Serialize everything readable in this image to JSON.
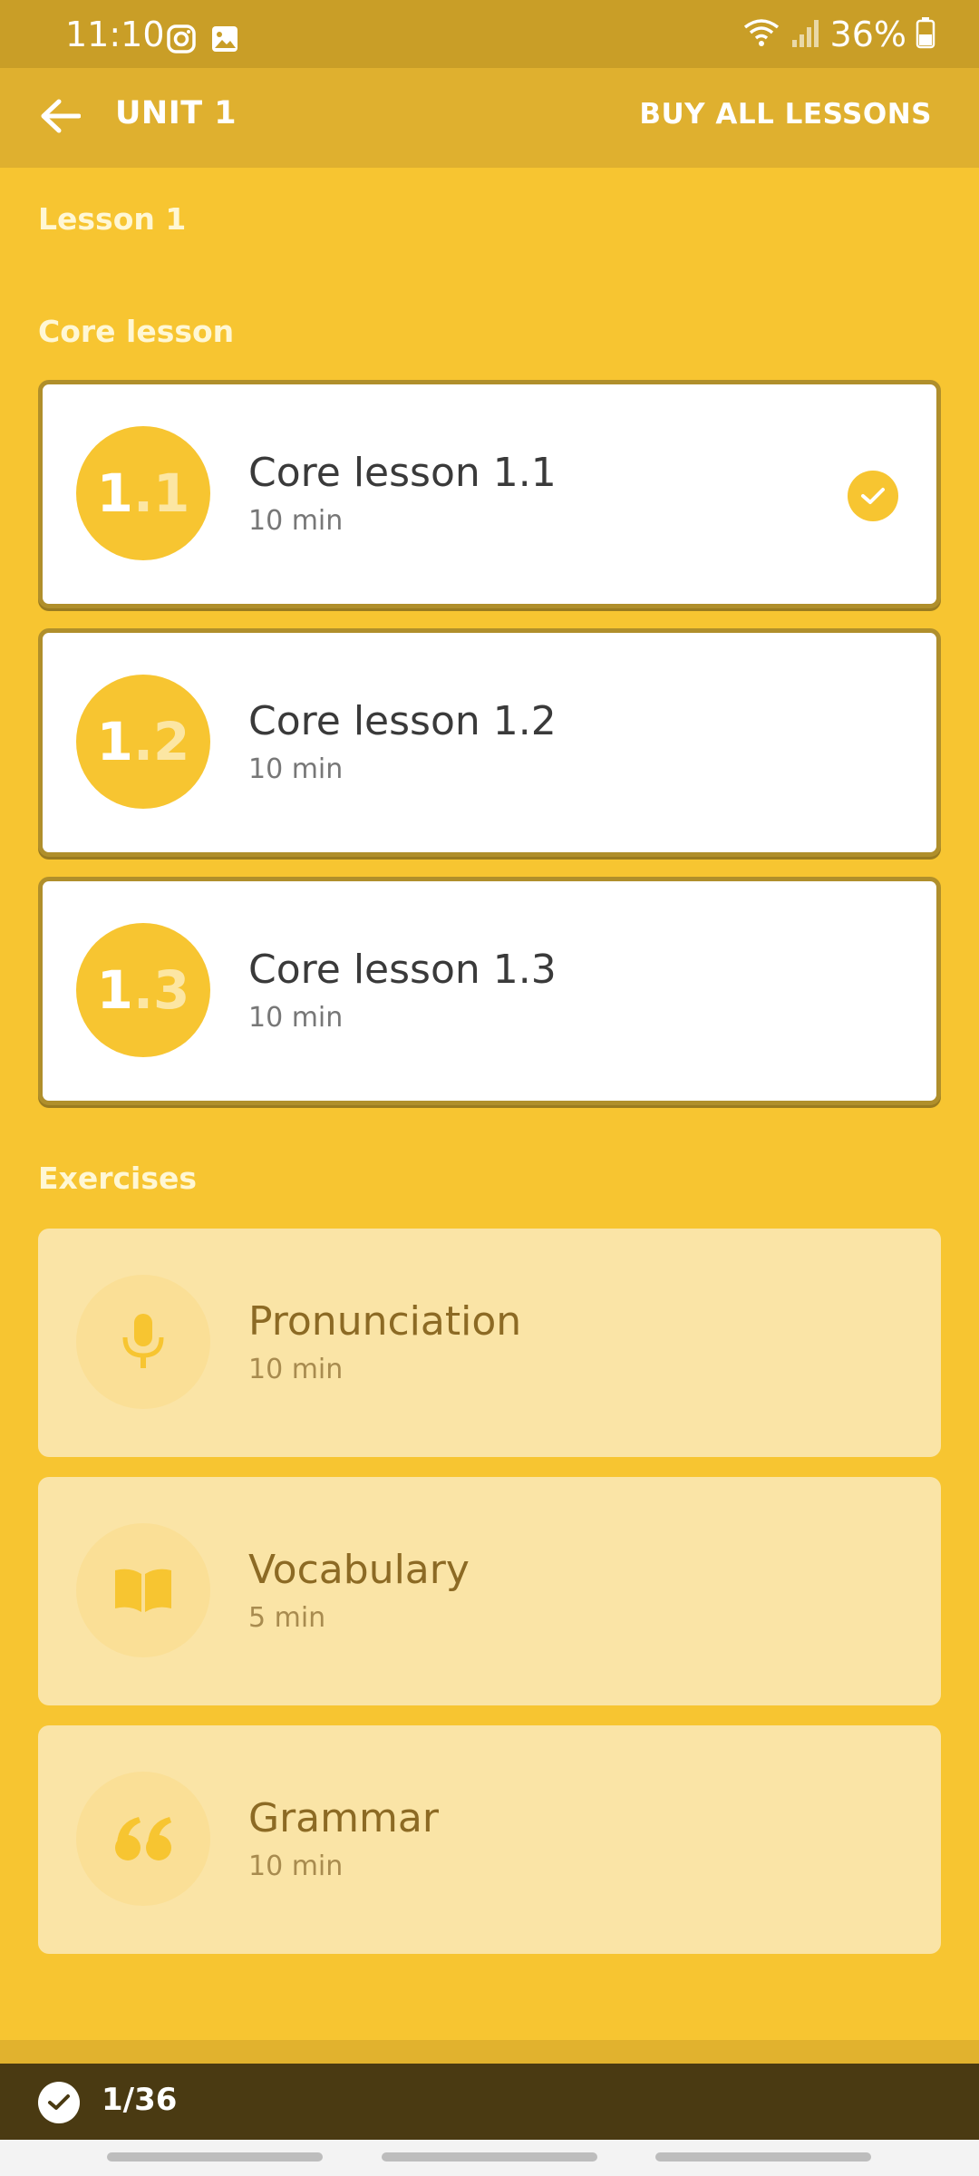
{
  "status_bar": {
    "time": "11:10",
    "battery": "36%"
  },
  "app_bar": {
    "title": "UNIT 1",
    "buy_all_label": "BUY ALL LESSONS"
  },
  "lesson_heading": "Lesson 1",
  "core_section": {
    "title": "Core lesson",
    "items": [
      {
        "badge_main": "1",
        "badge_dot": ".1",
        "title": "Core lesson 1.1",
        "duration": "10 min",
        "completed": true
      },
      {
        "badge_main": "1",
        "badge_dot": ".2",
        "title": "Core lesson 1.2",
        "duration": "10 min",
        "completed": false
      },
      {
        "badge_main": "1",
        "badge_dot": ".3",
        "title": "Core lesson 1.3",
        "duration": "10 min",
        "completed": false
      }
    ]
  },
  "exercises_section": {
    "title": "Exercises",
    "items": [
      {
        "icon": "microphone-icon",
        "title": "Pronunciation",
        "duration": "10 min"
      },
      {
        "icon": "book-icon",
        "title": "Vocabulary",
        "duration": "5 min"
      },
      {
        "icon": "quote-icon",
        "title": "Grammar",
        "duration": "10 min"
      }
    ]
  },
  "progress": {
    "text": "1/36"
  },
  "colors": {
    "background": "#f7c531",
    "app_bar": "#dfb02f",
    "status_bar": "#c99e27",
    "progress_bar": "#4a3a12"
  }
}
